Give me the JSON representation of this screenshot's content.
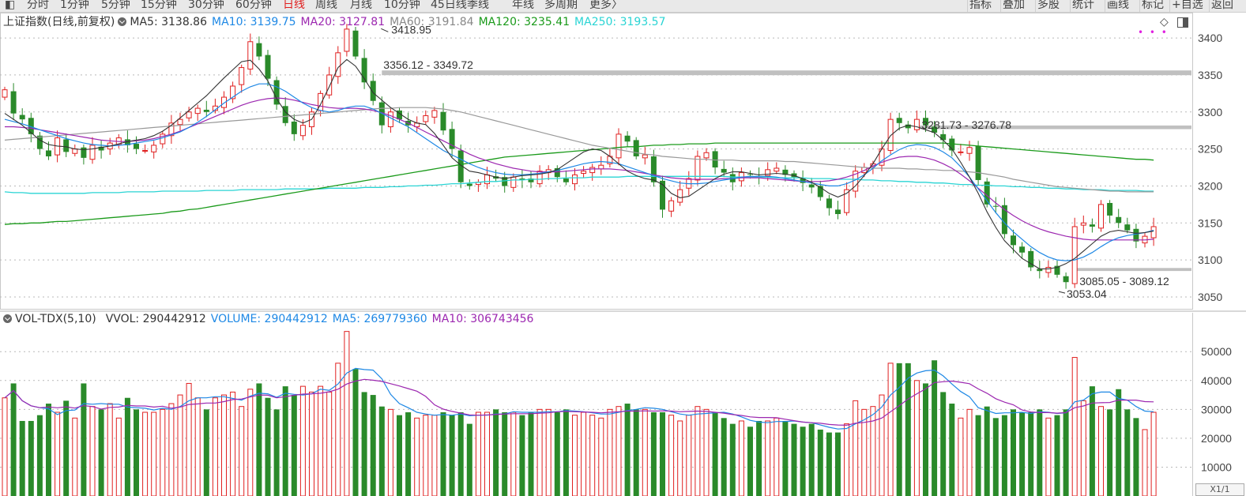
{
  "toolbar": {
    "periods": [
      "分时",
      "1分钟",
      "5分钟",
      "15分钟",
      "30分钟",
      "60分钟",
      "日线",
      "周线",
      "月线",
      "10分钟",
      "45日线",
      "季线",
      "年线",
      "多周期",
      "更多〉"
    ],
    "active_index": 6,
    "right_tools": [
      "指标",
      "叠加",
      "多股",
      "统计",
      "画线",
      "标记",
      "+自选",
      "返回"
    ]
  },
  "price_panel": {
    "title": "上证指数(日线,前复权)",
    "ma_labels": [
      {
        "text": "MA5: 3138.86",
        "color": "#333333"
      },
      {
        "text": "MA10: 3139.75",
        "color": "#1e88e5"
      },
      {
        "text": "MA20: 3127.81",
        "color": "#9c27b0"
      },
      {
        "text": "MA60: 3191.84",
        "color": "#888888"
      },
      {
        "text": "MA120: 3235.41",
        "color": "#1a9a1a"
      },
      {
        "text": "MA250: 3193.57",
        "color": "#2ad4d4"
      }
    ],
    "annotations": {
      "high": "3418.95",
      "gap1": "3356.12 - 3349.72",
      "gap2": "3281.73 - 3276.78",
      "gap3": "3085.05 - 3089.12",
      "low": "3053.04"
    },
    "y_ticks": [
      "3400",
      "3350",
      "3300",
      "3250",
      "3200",
      "3150",
      "3100",
      "3050"
    ]
  },
  "volume_panel": {
    "title": "VOL-TDX(5,10)",
    "labels": [
      {
        "text": "VVOL: 290442912",
        "color": "#333333"
      },
      {
        "text": "VOLUME: 290442912",
        "color": "#1e88e5"
      },
      {
        "text": "MA5: 269779360",
        "color": "#1e88e5"
      },
      {
        "text": "MA10: 306743456",
        "color": "#9c27b0"
      }
    ],
    "y_ticks": [
      "50000",
      "40000",
      "30000",
      "20000",
      "10000"
    ],
    "scale_label": "X1/1"
  },
  "colors": {
    "up": "#e02020",
    "down": "#2a8a2a",
    "grid": "#b9b9b9"
  },
  "chart_data": {
    "type": "candlestick",
    "ylim": [
      3035,
      3430
    ],
    "vol_ylim": [
      0,
      58000
    ],
    "close": [
      3330,
      3298,
      3290,
      3270,
      3250,
      3240,
      3265,
      3246,
      3250,
      3238,
      3255,
      3248,
      3258,
      3265,
      3255,
      3250,
      3248,
      3255,
      3270,
      3285,
      3290,
      3300,
      3305,
      3300,
      3308,
      3320,
      3335,
      3360,
      3395,
      3375,
      3345,
      3310,
      3285,
      3270,
      3282,
      3300,
      3325,
      3350,
      3380,
      3412,
      3375,
      3340,
      3315,
      3282,
      3300,
      3290,
      3282,
      3285,
      3295,
      3302,
      3275,
      3250,
      3205,
      3200,
      3205,
      3215,
      3210,
      3200,
      3212,
      3208,
      3205,
      3220,
      3222,
      3212,
      3205,
      3215,
      3220,
      3225,
      3228,
      3240,
      3270,
      3260,
      3240,
      3242,
      3205,
      3168,
      3180,
      3195,
      3210,
      3240,
      3245,
      3225,
      3218,
      3205,
      3218,
      3215,
      3212,
      3222,
      3224,
      3215,
      3212,
      3204,
      3198,
      3185,
      3170,
      3162,
      3195,
      3220,
      3225,
      3230,
      3250,
      3290,
      3285,
      3278,
      3290,
      3282,
      3272,
      3262,
      3248,
      3246,
      3252,
      3208,
      3175,
      3172,
      3135,
      3120,
      3110,
      3090,
      3085,
      3090,
      3080,
      3070,
      3145,
      3150,
      3145,
      3175,
      3160,
      3150,
      3140,
      3125,
      3132,
      3145
    ],
    "ma5": [
      3298,
      3290,
      3282,
      3272,
      3262,
      3256,
      3254,
      3253,
      3250,
      3249,
      3250,
      3252,
      3254,
      3257,
      3260,
      3262,
      3264,
      3268,
      3274,
      3282,
      3292,
      3302,
      3312,
      3322,
      3334,
      3346,
      3357,
      3368,
      3370,
      3358,
      3342,
      3318,
      3300,
      3290,
      3285,
      3290,
      3310,
      3334,
      3360,
      3371,
      3362,
      3345,
      3326,
      3316,
      3306,
      3298,
      3290,
      3285,
      3283,
      3271,
      3255,
      3238,
      3228,
      3220,
      3218,
      3215,
      3212,
      3210,
      3212,
      3214,
      3215,
      3216,
      3218,
      3222,
      3230,
      3238,
      3246,
      3250,
      3248,
      3240,
      3230,
      3220,
      3214,
      3210,
      3208,
      3202,
      3190,
      3184,
      3186,
      3194,
      3202,
      3210,
      3216,
      3219,
      3219,
      3217,
      3215,
      3216,
      3217,
      3216,
      3214,
      3210,
      3205,
      3198,
      3190,
      3185,
      3190,
      3200,
      3214,
      3230,
      3250,
      3268,
      3278,
      3282,
      3280,
      3276,
      3272,
      3262,
      3250,
      3232,
      3212,
      3190,
      3165,
      3144,
      3126,
      3114,
      3102,
      3095,
      3088,
      3088,
      3090,
      3095,
      3102,
      3112,
      3122,
      3132,
      3138,
      3140,
      3138,
      3136,
      3137,
      3139
    ],
    "ma10": [
      3290,
      3287,
      3284,
      3280,
      3276,
      3272,
      3268,
      3264,
      3261,
      3258,
      3256,
      3255,
      3254,
      3255,
      3256,
      3258,
      3260,
      3262,
      3265,
      3269,
      3273,
      3279,
      3286,
      3294,
      3303,
      3312,
      3320,
      3328,
      3334,
      3338,
      3338,
      3334,
      3328,
      3320,
      3312,
      3306,
      3302,
      3300,
      3302,
      3306,
      3308,
      3308,
      3304,
      3298,
      3292,
      3286,
      3280,
      3272,
      3264,
      3256,
      3248,
      3242,
      3236,
      3230,
      3225,
      3221,
      3218,
      3216,
      3215,
      3215,
      3216,
      3217,
      3219,
      3221,
      3224,
      3227,
      3230,
      3232,
      3233,
      3232,
      3230,
      3226,
      3222,
      3218,
      3214,
      3210,
      3207,
      3204,
      3203,
      3203,
      3204,
      3206,
      3208,
      3210,
      3212,
      3213,
      3213,
      3213,
      3212,
      3210,
      3208,
      3206,
      3204,
      3202,
      3200,
      3200,
      3203,
      3208,
      3215,
      3224,
      3234,
      3242,
      3249,
      3254,
      3256,
      3255,
      3252,
      3246,
      3238,
      3226,
      3212,
      3196,
      3180,
      3164,
      3150,
      3138,
      3128,
      3118,
      3110,
      3104,
      3100,
      3099,
      3100,
      3104,
      3110,
      3118,
      3125,
      3130,
      3133,
      3135,
      3137,
      3140
    ],
    "ma20": [
      3280,
      3280,
      3279,
      3278,
      3276,
      3274,
      3272,
      3270,
      3268,
      3266,
      3264,
      3262,
      3261,
      3260,
      3260,
      3261,
      3262,
      3264,
      3267,
      3270,
      3274,
      3279,
      3284,
      3289,
      3294,
      3299,
      3304,
      3309,
      3313,
      3316,
      3318,
      3319,
      3318,
      3316,
      3313,
      3310,
      3308,
      3306,
      3305,
      3305,
      3305,
      3304,
      3302,
      3299,
      3295,
      3290,
      3285,
      3279,
      3273,
      3267,
      3261,
      3255,
      3249,
      3243,
      3238,
      3234,
      3230,
      3227,
      3224,
      3222,
      3220,
      3219,
      3219,
      3219,
      3220,
      3221,
      3222,
      3223,
      3223,
      3223,
      3222,
      3221,
      3219,
      3217,
      3215,
      3213,
      3211,
      3210,
      3209,
      3209,
      3209,
      3209,
      3210,
      3210,
      3211,
      3211,
      3211,
      3210,
      3209,
      3208,
      3207,
      3206,
      3206,
      3206,
      3207,
      3209,
      3212,
      3216,
      3221,
      3227,
      3232,
      3236,
      3239,
      3240,
      3240,
      3238,
      3235,
      3230,
      3224,
      3216,
      3207,
      3197,
      3187,
      3177,
      3168,
      3160,
      3153,
      3147,
      3142,
      3138,
      3135,
      3132,
      3130,
      3128,
      3127,
      3127,
      3127,
      3127,
      3127,
      3127,
      3127,
      3128
    ],
    "ma60": [
      3262,
      3263,
      3264,
      3265,
      3266,
      3267,
      3268,
      3269,
      3270,
      3271,
      3272,
      3273,
      3274,
      3275,
      3276,
      3277,
      3278,
      3279,
      3280,
      3281,
      3282,
      3283,
      3284,
      3285,
      3286,
      3287,
      3288,
      3289,
      3290,
      3291,
      3292,
      3293,
      3294,
      3295,
      3296,
      3297,
      3298,
      3299,
      3300,
      3301,
      3302,
      3303,
      3304,
      3305,
      3305,
      3306,
      3306,
      3306,
      3306,
      3305,
      3304,
      3302,
      3300,
      3297,
      3294,
      3291,
      3288,
      3285,
      3282,
      3279,
      3276,
      3273,
      3270,
      3267,
      3264,
      3261,
      3258,
      3255,
      3253,
      3251,
      3249,
      3247,
      3245,
      3243,
      3242,
      3240,
      3239,
      3238,
      3237,
      3236,
      3236,
      3235,
      3235,
      3235,
      3234,
      3234,
      3234,
      3234,
      3234,
      3233,
      3233,
      3232,
      3231,
      3230,
      3229,
      3228,
      3227,
      3226,
      3225,
      3224,
      3224,
      3224,
      3224,
      3223,
      3223,
      3222,
      3222,
      3221,
      3221,
      3220,
      3219,
      3218,
      3216,
      3214,
      3212,
      3209,
      3207,
      3205,
      3203,
      3201,
      3199,
      3198,
      3197,
      3196,
      3195,
      3194,
      3193,
      3193,
      3192,
      3192,
      3192,
      3192
    ],
    "ma120": [
      3148,
      3149,
      3149,
      3150,
      3150,
      3151,
      3152,
      3152,
      3153,
      3154,
      3155,
      3156,
      3157,
      3158,
      3159,
      3160,
      3161,
      3162,
      3163,
      3165,
      3166,
      3168,
      3169,
      3171,
      3173,
      3175,
      3177,
      3179,
      3181,
      3183,
      3185,
      3187,
      3189,
      3191,
      3193,
      3195,
      3197,
      3199,
      3201,
      3203,
      3205,
      3207,
      3209,
      3211,
      3213,
      3215,
      3217,
      3219,
      3221,
      3223,
      3225,
      3227,
      3229,
      3231,
      3233,
      3235,
      3237,
      3239,
      3240,
      3241,
      3242,
      3243,
      3244,
      3245,
      3246,
      3247,
      3248,
      3249,
      3250,
      3251,
      3252,
      3253,
      3253,
      3254,
      3255,
      3255,
      3256,
      3256,
      3257,
      3257,
      3257,
      3258,
      3258,
      3258,
      3258,
      3258,
      3258,
      3258,
      3258,
      3258,
      3258,
      3258,
      3258,
      3258,
      3258,
      3258,
      3258,
      3258,
      3258,
      3258,
      3258,
      3258,
      3258,
      3258,
      3258,
      3258,
      3258,
      3258,
      3257,
      3256,
      3255,
      3254,
      3253,
      3252,
      3251,
      3250,
      3249,
      3248,
      3247,
      3246,
      3245,
      3244,
      3243,
      3242,
      3241,
      3240,
      3239,
      3238,
      3237,
      3236,
      3236,
      3235
    ],
    "ma250": [
      3192,
      3191,
      3191,
      3190,
      3190,
      3190,
      3190,
      3190,
      3190,
      3190,
      3191,
      3191,
      3191,
      3191,
      3192,
      3192,
      3192,
      3192,
      3193,
      3193,
      3193,
      3193,
      3193,
      3194,
      3194,
      3194,
      3194,
      3195,
      3195,
      3195,
      3195,
      3195,
      3196,
      3196,
      3196,
      3196,
      3196,
      3197,
      3197,
      3197,
      3197,
      3198,
      3198,
      3198,
      3199,
      3199,
      3200,
      3200,
      3201,
      3201,
      3202,
      3203,
      3203,
      3204,
      3205,
      3206,
      3206,
      3207,
      3208,
      3208,
      3209,
      3209,
      3210,
      3210,
      3211,
      3211,
      3211,
      3212,
      3212,
      3212,
      3212,
      3213,
      3213,
      3213,
      3213,
      3213,
      3213,
      3213,
      3213,
      3213,
      3213,
      3213,
      3213,
      3212,
      3212,
      3212,
      3212,
      3212,
      3211,
      3211,
      3211,
      3211,
      3210,
      3210,
      3210,
      3209,
      3209,
      3209,
      3208,
      3208,
      3207,
      3207,
      3206,
      3206,
      3205,
      3205,
      3204,
      3204,
      3203,
      3202,
      3202,
      3201,
      3201,
      3200,
      3200,
      3199,
      3199,
      3198,
      3198,
      3197,
      3197,
      3196,
      3196,
      3195,
      3195,
      3195,
      3194,
      3194,
      3194,
      3194,
      3193,
      3193
    ],
    "volume": [
      34000,
      39000,
      26000,
      26000,
      28000,
      32000,
      29000,
      33000,
      27000,
      39000,
      31000,
      30000,
      32000,
      27000,
      34000,
      30000,
      29000,
      29000,
      30000,
      32000,
      35000,
      39000,
      34000,
      30000,
      34000,
      35000,
      36000,
      31000,
      37000,
      39000,
      34000,
      30000,
      38000,
      35000,
      38000,
      36000,
      38000,
      36000,
      46000,
      57000,
      44000,
      36000,
      35000,
      31000,
      30000,
      28000,
      29000,
      27000,
      28000,
      28000,
      29000,
      28000,
      29000,
      25000,
      29000,
      29000,
      30000,
      29000,
      29000,
      28000,
      29000,
      30000,
      30000,
      29000,
      30000,
      28000,
      29000,
      28000,
      27000,
      30000,
      31000,
      32000,
      30000,
      30000,
      29000,
      29000,
      28000,
      26000,
      28000,
      31000,
      30000,
      29000,
      27000,
      25000,
      26000,
      24000,
      26000,
      26000,
      27000,
      26000,
      25000,
      24000,
      25000,
      23000,
      22000,
      22000,
      25000,
      33000,
      30000,
      31000,
      35000,
      46000,
      46000,
      46000,
      40000,
      39000,
      47000,
      36000,
      32000,
      27000,
      30000,
      28000,
      31000,
      27000,
      28000,
      30000,
      29000,
      29000,
      30000,
      27000,
      28000,
      30000,
      48000,
      33000,
      38000,
      31000,
      30000,
      37000,
      30000,
      27000,
      23000,
      29000
    ]
  }
}
